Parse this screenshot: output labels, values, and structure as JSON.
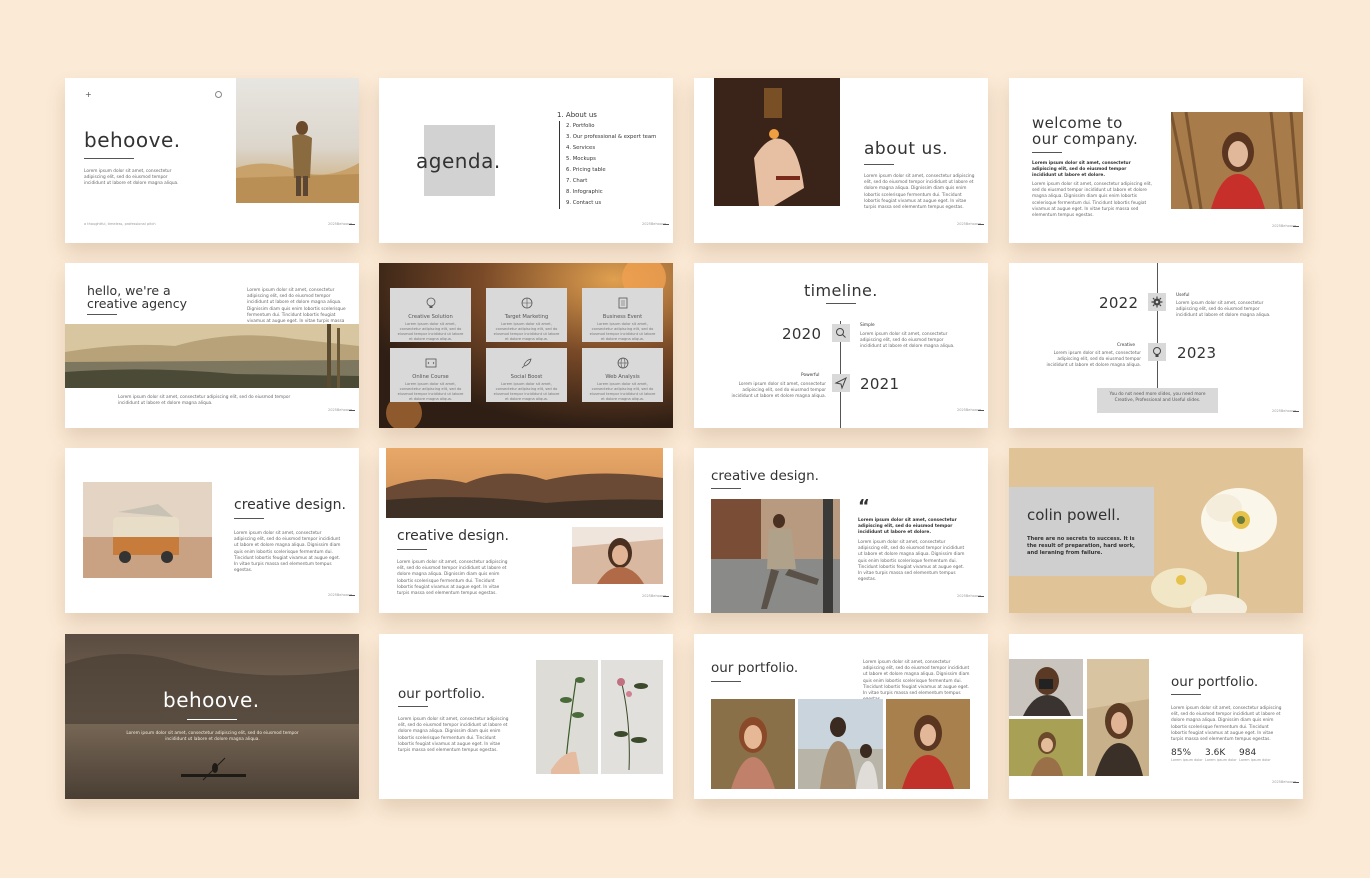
{
  "palette": {
    "background": "#fbead6",
    "slide": "#ffffff",
    "accent_gray": "#d2d2d2",
    "text": "#333333"
  },
  "lorem": {
    "short": "Lorem ipsum dolor sit amet, consectetur adipiscing elit, sed do eiusmod tempor incididunt ut labore et dolore magna aliqua.",
    "long": "Lorem ipsum dolor sit amet, consectetur adipiscing elit, sed do eiusmod tempor incididunt ut labore et dolore magna aliqua. Dignissim diam quis enim lobortis scelerisque fermentum dui. Tincidunt lobortis feugiat vivamus at augue eget. In vitae turpis massa sed elementum tempus egestas.",
    "bold": "Lorem ipsum dolor sit amet, consectetur adipiscing elit, sed do eiusmod tempor incididunt ut labore et dolore."
  },
  "footer_text": "2025Behoove",
  "slide01": {
    "title": "behoove.",
    "caption": "a thoughtful, timeless, professional pitch"
  },
  "slide02": {
    "title": "agenda.",
    "items": [
      "1. About us",
      "2. Portfolio",
      "3. Our professional & expert team",
      "4. Services",
      "5. Mockups",
      "6. Pricing table",
      "7. Chart",
      "8. Infographic",
      "9. Contact us"
    ]
  },
  "slide03": {
    "title": "about us."
  },
  "slide04": {
    "title_line1": "welcome to",
    "title_line2": "our company."
  },
  "slide05": {
    "title_line1": "hello, we're a",
    "title_line2": "creative agency"
  },
  "slide06": {
    "services": [
      {
        "label": "Creative Solution",
        "icon": "lightbulb-icon"
      },
      {
        "label": "Target Marketing",
        "icon": "globe-icon"
      },
      {
        "label": "Business Event",
        "icon": "document-icon"
      },
      {
        "label": "Online Course",
        "icon": "code-icon"
      },
      {
        "label": "Social Boost",
        "icon": "rocket-icon"
      },
      {
        "label": "Web Analysis",
        "icon": "web-icon"
      }
    ]
  },
  "slide07": {
    "title": "timeline.",
    "year1": "2020",
    "year2": "2021",
    "label1": "Simple",
    "label2": "Powerful"
  },
  "slide08": {
    "year1": "2022",
    "year2": "2023",
    "label1": "Useful",
    "label2": "Creative",
    "note": "You do not need more slides, you need more Creative, Professional and Useful slides."
  },
  "slide09": {
    "title": "creative design."
  },
  "slide10": {
    "title": "creative design."
  },
  "slide11": {
    "title": "creative design.",
    "quote_mark": "“"
  },
  "slide12": {
    "title": "colin powell.",
    "quote": "There are no secrets to success. It is the result of preparation, hard work, and leraning from failure."
  },
  "slide13": {
    "title": "behoove."
  },
  "slide14": {
    "title": "our portfolio."
  },
  "slide15": {
    "title": "our portfolio."
  },
  "slide16": {
    "title": "our portfolio.",
    "stats": [
      {
        "value": "85%",
        "label": "Lorem ipsum dolor"
      },
      {
        "value": "3.6K",
        "label": "Lorem ipsum dolor"
      },
      {
        "value": "984",
        "label": "Lorem ipsum dolor"
      }
    ]
  }
}
